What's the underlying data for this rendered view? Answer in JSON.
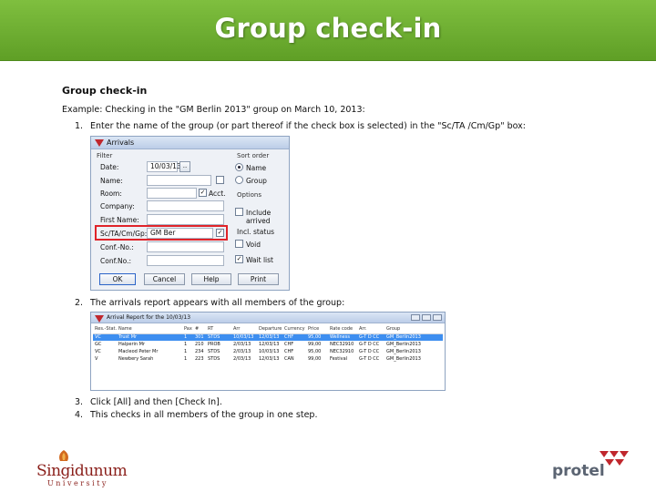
{
  "slide": {
    "title": "Group check-in",
    "doc_title": "Group check-in",
    "example": "Example: Checking in the \"GM Berlin 2013\" group on March 10, 2013:",
    "steps": [
      {
        "num": "1.",
        "text": "Enter the name of the group (or part thereof if the check box is selected) in the \"Sc/TA /Cm/Gp\" box:"
      },
      {
        "num": "2.",
        "text": "The arrivals report appears with all members of the group:"
      },
      {
        "num": "3.",
        "text": "Click [All] and then [Check In]."
      },
      {
        "num": "4.",
        "text": "This checks in all members of the group in one step."
      }
    ]
  },
  "arrivals_dialog": {
    "title": "Arrivals",
    "filter_label": "Filter",
    "sort_order_label": "Sort order",
    "options_label": "Options",
    "fields": {
      "date_label": "Date:",
      "date_value": "10/03/13",
      "date_btn": "..",
      "name_label": "Name:",
      "room_label": "Room:",
      "acct_label": "Acct.",
      "company_label": "Company:",
      "first_name_label": "First Name:",
      "sc_label": "Sc/TA/Cm/Gp:",
      "sc_value": "GM Ber",
      "conf_no1_label": "Conf.-No.:",
      "conf_no2_label": "Conf.No.:"
    },
    "sort": {
      "name": "Name",
      "group": "Group"
    },
    "include_arrived": "Include arrived",
    "incl_status": "Incl. status",
    "void": "Void",
    "wait_list": "Wait list",
    "buttons": {
      "ok": "OK",
      "cancel": "Cancel",
      "help": "Help",
      "print": "Print"
    }
  },
  "arrivals_report": {
    "title": "Arrival Report for the 10/03/13",
    "columns": [
      "Res.-Stat.",
      "Name",
      "Pax",
      "#",
      "RT",
      "Arr",
      "Departure",
      "Currency",
      "Price",
      "Rate code",
      "Arr.",
      "Group"
    ],
    "rows": [
      [
        "VC",
        "Trust Mr",
        "1",
        "301",
        "STDS",
        "10/03/13",
        "12/03/13",
        "CHF",
        "95,00",
        "Wellness",
        "G-T D CC",
        "GM_Berlin2013"
      ],
      [
        "GC",
        "Halperin Mr",
        "1",
        "210",
        "PROB",
        "2/03/13",
        "12/03/13",
        "CHF",
        "99,00",
        "NEC32910",
        "G-T D CC",
        "GM_Berlin2013"
      ],
      [
        "VC",
        "Macleod Peter Mr",
        "1",
        "234",
        "STDS",
        "2/03/13",
        "10/03/13",
        "CHF",
        "95,00",
        "NEC32910",
        "G-T D CC",
        "GM_Berlin2013"
      ],
      [
        "V",
        "Newbery Sarah",
        "1",
        "223",
        "STDS",
        "2/03/13",
        "12/03/13",
        "CAN",
        "99,00",
        "Festival",
        "G-T D CC",
        "GM_Berlin2013"
      ]
    ]
  },
  "logos": {
    "left_name": "Singidunum",
    "left_sub": "University",
    "right_name": "protel"
  },
  "colors": {
    "header_green": "#6aab2f",
    "highlight_red": "#e0242a",
    "selection_blue": "#3d8ef0"
  }
}
